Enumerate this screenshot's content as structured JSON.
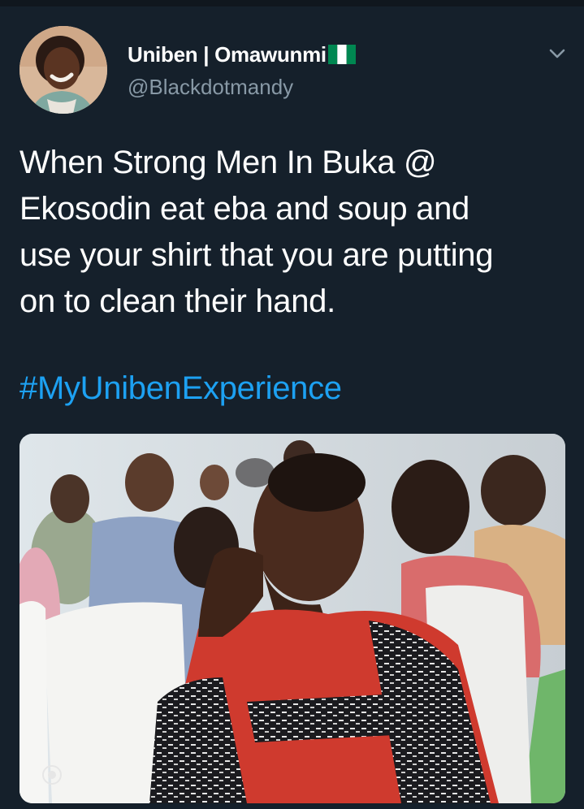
{
  "user": {
    "display_name": "Uniben | Omawunmi",
    "flag_icon": "nigeria-flag-icon",
    "handle": "@Blackdotmandy",
    "avatar_icon": "user-avatar"
  },
  "menu": {
    "icon": "chevron-down-icon"
  },
  "tweet": {
    "lines": [
      "When Strong Men In Buka @",
      "Ekosodin eat eba and soup and",
      "use your shirt that you are putting",
      "on to clean their hand."
    ],
    "hashtag": "#MyUnibenExperience"
  },
  "media": {
    "icon": "photo-attachment"
  },
  "colors": {
    "background": "#15202b",
    "text": "#ffffff",
    "secondary_text": "#8899a6",
    "link": "#1da1f2",
    "flag_green": "#008751"
  }
}
